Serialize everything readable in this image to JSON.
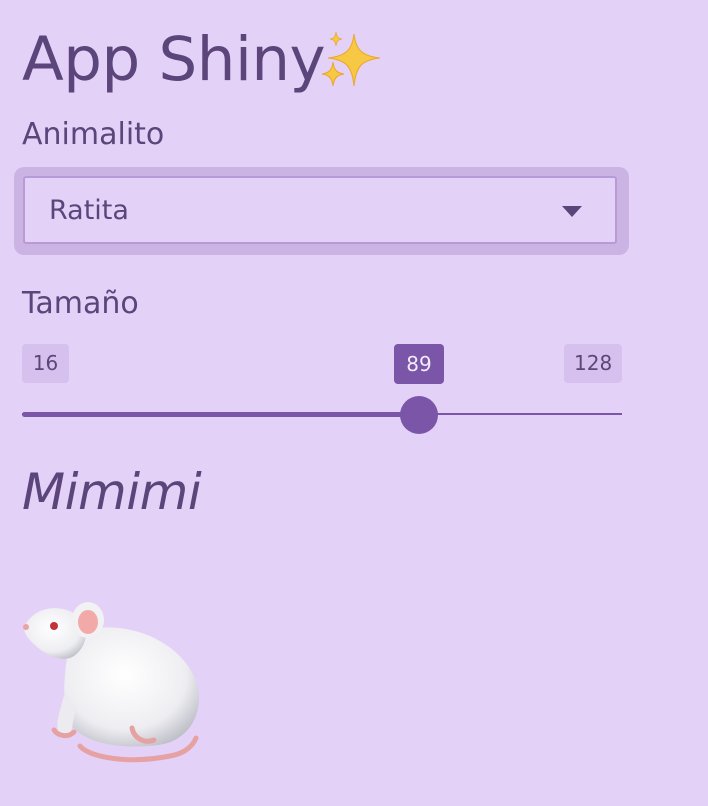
{
  "app": {
    "title": "App Shiny",
    "title_icon": "sparkles-icon"
  },
  "animal_select": {
    "label": "Animalito",
    "selected": "Ratita"
  },
  "size_slider": {
    "label": "Tamaño",
    "min": 16,
    "max": 128,
    "value": 89
  },
  "output": {
    "heading": "Mimimi",
    "image_icon": "rat-icon"
  },
  "colors": {
    "background": "#e4d1f7",
    "accent": "#7a55a8",
    "text": "#5c457a"
  }
}
